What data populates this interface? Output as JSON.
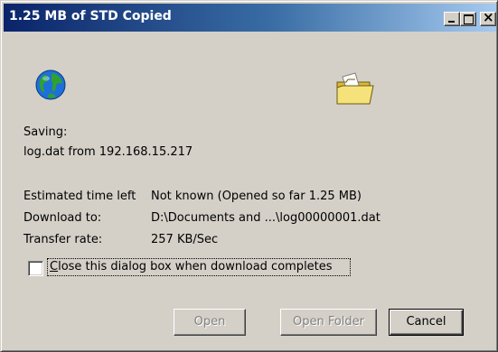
{
  "window": {
    "title": "1.25 MB of STD Copied",
    "controls": {
      "minimize": "minimize",
      "maximize": "maximize",
      "close": "close"
    }
  },
  "icons": {
    "source": "globe-icon",
    "destination": "folder-icon"
  },
  "status": {
    "action": "Saving:",
    "item": "log.dat from 192.168.15.217"
  },
  "details": {
    "time_left_label": "Estimated time left",
    "time_left_value": "Not known (Opened so far 1.25 MB)",
    "download_to_label": "Download to:",
    "download_to_value": "D:\\Documents and ...\\log00000001.dat",
    "transfer_rate_label": "Transfer rate:",
    "transfer_rate_value": "257 KB/Sec"
  },
  "options": {
    "close_when_done_label": "Close this dialog box when download completes",
    "close_when_done_checked": false
  },
  "buttons": {
    "open": "Open",
    "open_folder": "Open Folder",
    "cancel": "Cancel"
  },
  "colors": {
    "titlebar_start": "#0a246a",
    "titlebar_end": "#a6caf0",
    "face": "#d4d0c8",
    "disabled_text": "#808080"
  }
}
